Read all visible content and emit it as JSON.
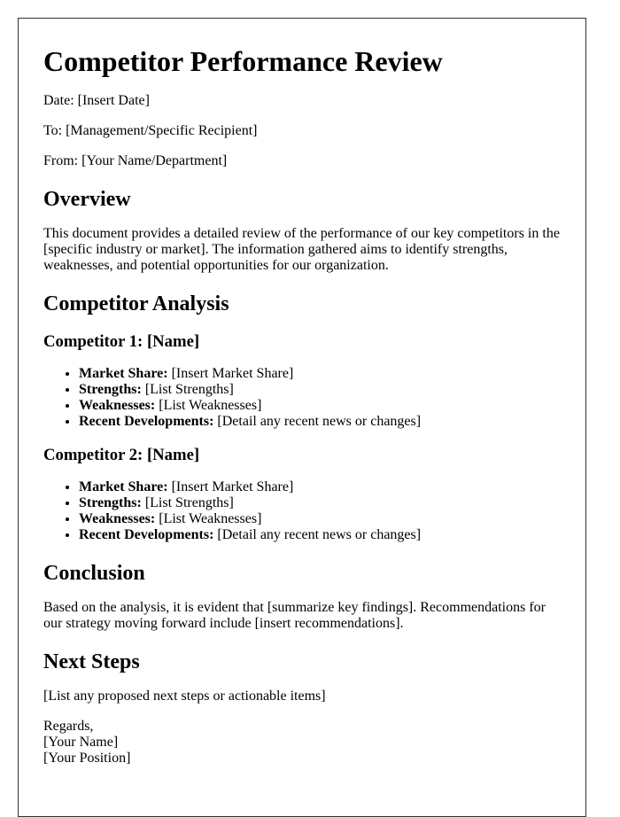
{
  "title": "Competitor Performance Review",
  "meta": {
    "date": "Date: [Insert Date]",
    "to": "To: [Management/Specific Recipient]",
    "from": "From: [Your Name/Department]"
  },
  "overview": {
    "heading": "Overview",
    "text": "This document provides a detailed review of the performance of our key competitors in the [specific industry or market]. The information gathered aims to identify strengths, weaknesses, and potential opportunities for our organization."
  },
  "analysis": {
    "heading": "Competitor Analysis",
    "competitors": [
      {
        "heading": "Competitor 1: [Name]",
        "items": [
          {
            "label": "Market Share:",
            "value": " [Insert Market Share]"
          },
          {
            "label": "Strengths:",
            "value": " [List Strengths]"
          },
          {
            "label": "Weaknesses:",
            "value": " [List Weaknesses]"
          },
          {
            "label": "Recent Developments:",
            "value": " [Detail any recent news or changes]"
          }
        ]
      },
      {
        "heading": "Competitor 2: [Name]",
        "items": [
          {
            "label": "Market Share:",
            "value": " [Insert Market Share]"
          },
          {
            "label": "Strengths:",
            "value": " [List Strengths]"
          },
          {
            "label": "Weaknesses:",
            "value": " [List Weaknesses]"
          },
          {
            "label": "Recent Developments:",
            "value": " [Detail any recent news or changes]"
          }
        ]
      }
    ]
  },
  "conclusion": {
    "heading": "Conclusion",
    "text": "Based on the analysis, it is evident that [summarize key findings]. Recommendations for our strategy moving forward include [insert recommendations]."
  },
  "next_steps": {
    "heading": "Next Steps",
    "text": "[List any proposed next steps or actionable items]"
  },
  "signature": {
    "closing": "Regards,",
    "name": "[Your Name]",
    "position": "[Your Position]"
  }
}
